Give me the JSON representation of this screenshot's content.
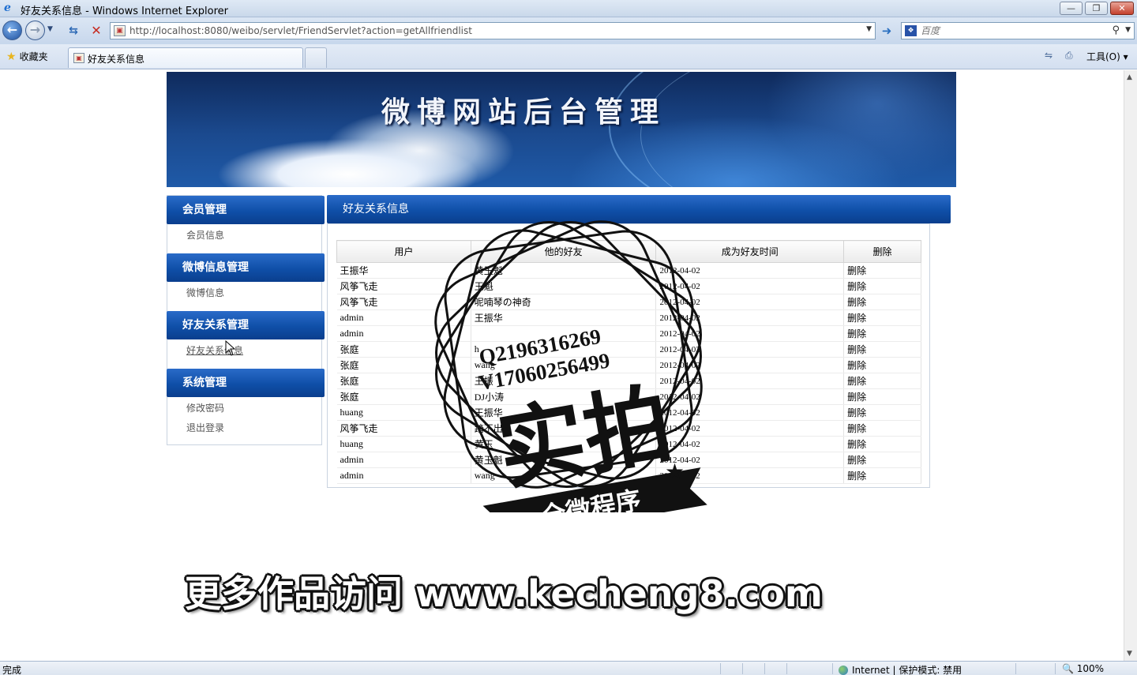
{
  "window": {
    "title": "好友关系信息 - Windows Internet Explorer",
    "min_glyph": "—",
    "max_glyph": "❐",
    "close_glyph": "✕"
  },
  "navbar": {
    "url": "http://localhost:8080/weibo/servlet/FriendServlet?action=getAllfriendlist",
    "search_placeholder": "百度"
  },
  "favbar": {
    "favorites_label": "收藏夹",
    "tab_label": "好友关系信息",
    "tools_label": "工具(O) ▾"
  },
  "banner": {
    "title": "微博网站后台管理"
  },
  "sidebar": {
    "sections": [
      {
        "title": "会员管理",
        "links": [
          "会员信息"
        ]
      },
      {
        "title": "微博信息管理",
        "links": [
          "微博信息"
        ]
      },
      {
        "title": "好友关系管理",
        "links": [
          "好友关系信息"
        ]
      },
      {
        "title": "系统管理",
        "links": [
          "修改密码",
          "退出登录"
        ]
      }
    ]
  },
  "content": {
    "title": "好友关系信息",
    "columns": [
      "用户",
      "他的好友",
      "成为好友时间",
      "删除"
    ],
    "rows": [
      {
        "user": "王振华",
        "friend": "黄玉魁",
        "date": "2012-04-02",
        "action": "删除"
      },
      {
        "user": "风筝飞走",
        "friend": "王魁",
        "date": "2012-04-02",
        "action": "删除"
      },
      {
        "user": "风筝飞走",
        "friend": "呢喃琴の神奇",
        "date": "2012-04-02",
        "action": "删除"
      },
      {
        "user": "admin",
        "friend": "王振华",
        "date": "2012-04-02",
        "action": "删除"
      },
      {
        "user": "admin",
        "friend": "",
        "date": "2012-04-02",
        "action": "删除"
      },
      {
        "user": "张庭",
        "friend": "h",
        "date": "2012-04-02",
        "action": "删除"
      },
      {
        "user": "张庭",
        "friend": "wang",
        "date": "2012-04-02",
        "action": "删除"
      },
      {
        "user": "张庭",
        "friend": "王振",
        "date": "2012-04-02",
        "action": "删除"
      },
      {
        "user": "张庭",
        "friend": "DJ小涛",
        "date": "2012-04-02",
        "action": "删除"
      },
      {
        "user": "huang",
        "friend": "王振华",
        "date": "2012-04-02",
        "action": "删除"
      },
      {
        "user": "风筝飞走",
        "friend": "踏不出",
        "date": "2012-04-02",
        "action": "删除"
      },
      {
        "user": "huang",
        "friend": "黄玉",
        "date": "2012-04-02",
        "action": "删除"
      },
      {
        "user": "admin",
        "friend": "黄玉魁",
        "date": "2012-04-02",
        "action": "删除"
      },
      {
        "user": "admin",
        "friend": "wang",
        "date": "2012-04-02",
        "action": "删除"
      }
    ]
  },
  "watermark": {
    "line1": "Q2196316269",
    "line2": "V17060256499",
    "big": "实拍",
    "ribbon": "全微程序",
    "promo": "更多作品访问 www.kecheng8.com"
  },
  "statusbar": {
    "left": "完成",
    "zone": "Internet | 保护模式: 禁用",
    "zoom": "🔍 100%"
  }
}
